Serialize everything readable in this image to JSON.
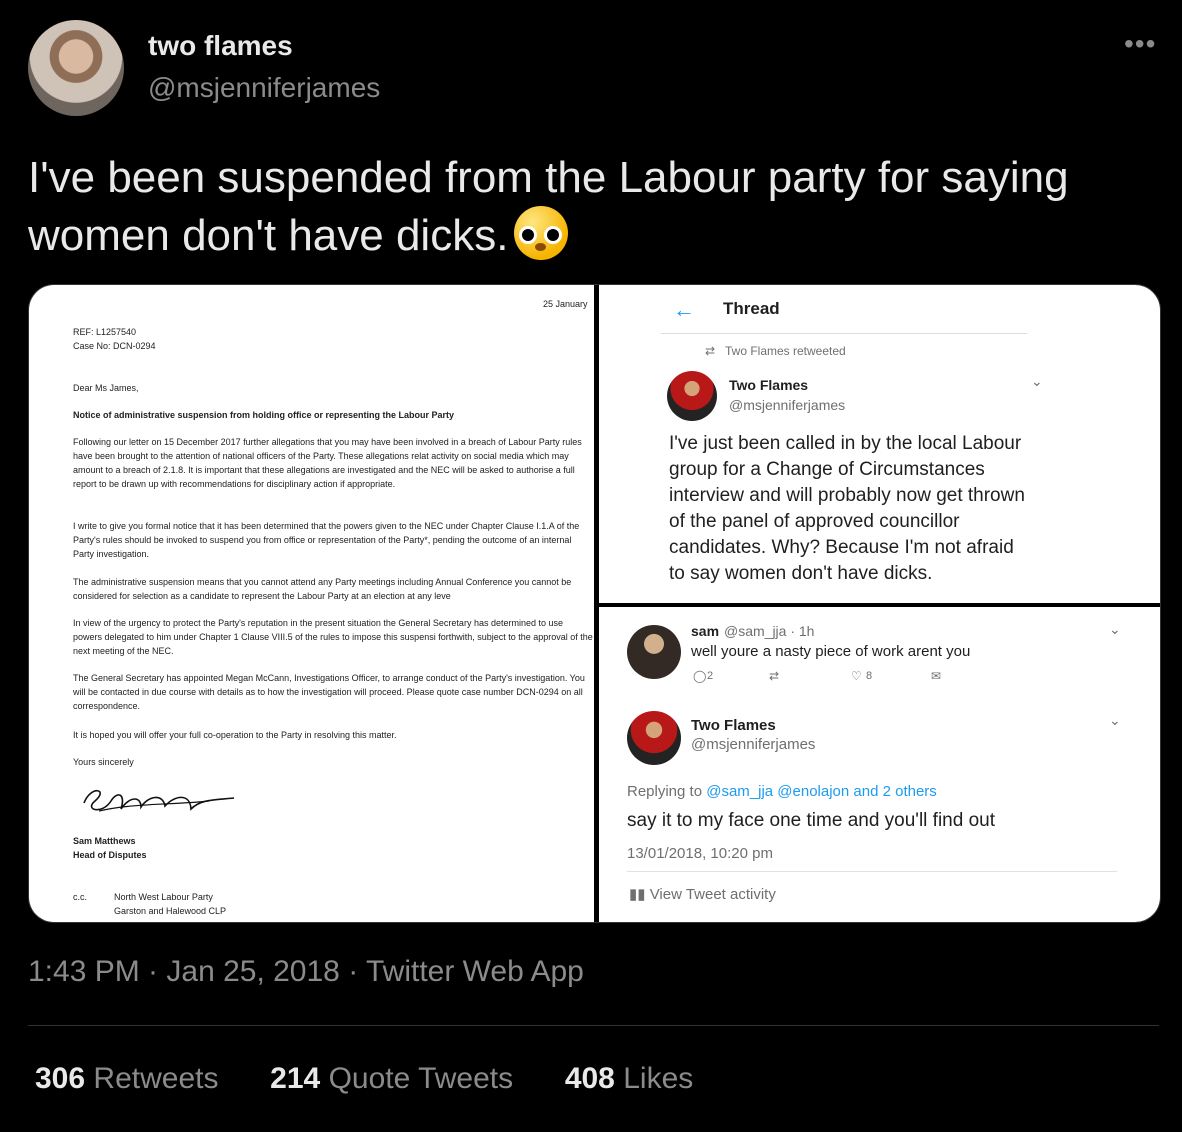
{
  "author": {
    "name": "two flames",
    "handle": "@msjenniferjames"
  },
  "tweet": {
    "text": "I've been suspended from the Labour party for saying women don't have dicks.",
    "emoji": "flushed-face-icon"
  },
  "letter": {
    "date": "25 January",
    "ref": "REF: L1257540",
    "case": "Case No: DCN-0294",
    "salutation": "Dear Ms James,",
    "heading": "Notice of administrative suspension from holding office or representing the Labour Party",
    "p1": "Following our letter on 15 December 2017 further allegations that you may have been involved in a breach of Labour Party rules have been brought to the attention of national officers of the Party. These allegations relat activity on social media which may amount to a breach of 2.1.8. It is important that these allegations are investigated and the NEC will be asked to authorise a full report to be drawn up with recommendations for disciplinary action if appropriate.",
    "p2": "I write to give you formal notice that it has been determined that the powers given to the NEC under Chapter Clause I.1.A of the Party's rules should be invoked to suspend you from office or representation of the Party*, pending the outcome of an internal Party investigation.",
    "p3": "The administrative suspension means that you cannot attend any Party meetings including Annual Conference you cannot be considered for selection as a candidate to represent the Labour Party at an election at any leve",
    "p4": "In view of the urgency to protect the Party's reputation in the present situation the General Secretary has determined to use powers delegated to him under Chapter 1 Clause VIII.5 of the rules to impose this suspensi forthwith, subject to the approval of the next meeting of the NEC.",
    "p5": "The General Secretary has appointed Megan McCann, Investigations Officer, to arrange conduct of the Party's investigation. You will be contacted in due course with details as to how the investigation will proceed. Please quote case number DCN-0294 on all correspondence.",
    "p6": "It is hoped you will offer your full co-operation to the Party in resolving this matter.",
    "closing": "Yours sincerely",
    "signatory": "Sam Matthews",
    "title": "Head of Disputes",
    "cc": "c.c.",
    "cc1": "North West Labour Party",
    "cc2": "Garston and Halewood CLP"
  },
  "thread": {
    "back": "←",
    "title": "Thread",
    "retweeted": "Two Flames retweeted",
    "name": "Two Flames",
    "handle": "@msjenniferjames",
    "text": "I've just been called in by the local Labour group for a Change of Circumstances interview and will probably now get thrown of the panel of approved councillor candidates. Why? Because I'm not afraid to say women don't have dicks."
  },
  "reply": {
    "sam_name": "sam",
    "sam_handle": "@sam_jja · 1h",
    "sam_text": "well youre a nasty piece of work arent you",
    "comment_count": "2",
    "like_count": "8",
    "name": "Two Flames",
    "handle": "@msjenniferjames",
    "replying_prefix": "Replying to",
    "replying_to": "@sam_jja @enolajon and 2 others",
    "text": "say it to my face one time and you'll find out",
    "time": "13/01/2018, 10:20 pm",
    "activity": "View Tweet activity"
  },
  "meta": {
    "time": "1:43 PM · Jan 25, 2018 · Twitter Web App"
  },
  "stats": {
    "retweets": "306",
    "retweets_label": "Retweets",
    "quotes": "214",
    "quotes_label": "Quote Tweets",
    "likes": "408",
    "likes_label": "Likes"
  }
}
